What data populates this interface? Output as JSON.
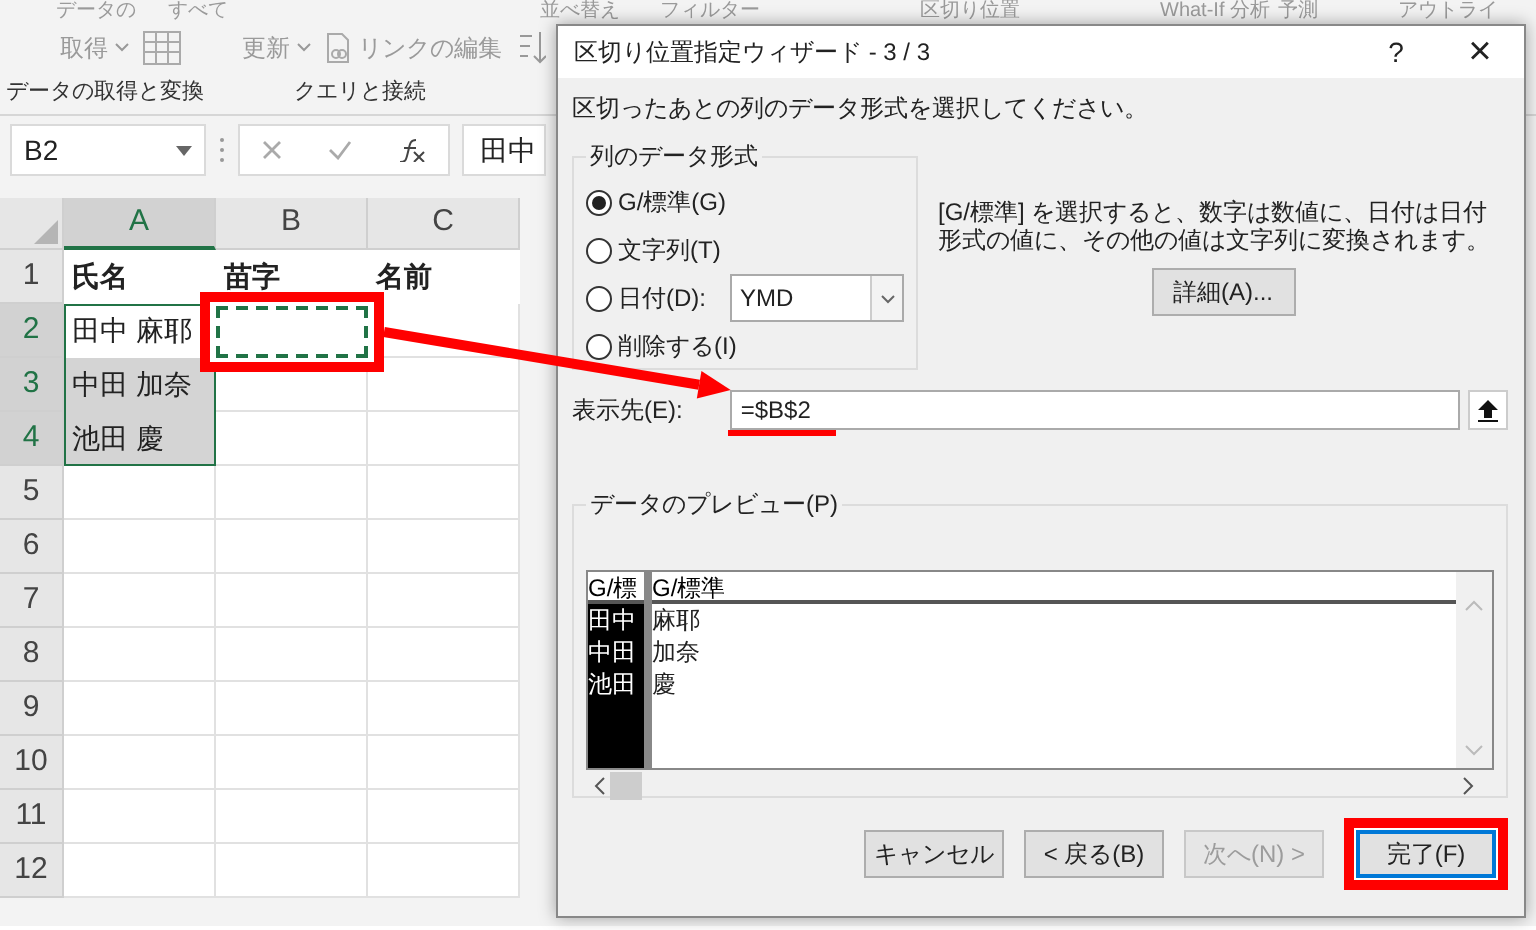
{
  "ribbon": {
    "top_items": [
      "データの",
      "すべて",
      "並べ替え",
      "フィルター",
      "区切り位置",
      "What-If 分析",
      "予測",
      "アウトライ"
    ],
    "buttons": [
      {
        "label": "取得",
        "kind": "dropdown_table"
      },
      {
        "label": "更新",
        "kind": "dropdown"
      },
      {
        "label": "リンクの編集",
        "kind": "link"
      },
      {
        "kind": "sort"
      }
    ],
    "groups": [
      "データの取得と変換",
      "クエリと接続"
    ]
  },
  "formula_bar": {
    "name_box": "B2",
    "value": "田中"
  },
  "sheet": {
    "columns": [
      {
        "label": "A",
        "selected": true
      },
      {
        "label": "B",
        "selected": false
      },
      {
        "label": "C",
        "selected": false
      }
    ],
    "rows": [
      {
        "header": "1",
        "selected": false,
        "kind": "heading",
        "cells": [
          {
            "text": "氏名",
            "selected": false
          },
          {
            "text": "苗字",
            "selected": false
          },
          {
            "text": "名前",
            "selected": false
          }
        ]
      },
      {
        "header": "2",
        "selected": true,
        "kind": "data",
        "cells": [
          {
            "text": "田中 麻耶",
            "selected": true,
            "active": true
          },
          {
            "highlighted": true
          }
        ]
      },
      {
        "header": "3",
        "selected": true,
        "kind": "data",
        "cells": [
          {
            "text": "中田 加奈",
            "selected": true,
            "active": false
          }
        ]
      },
      {
        "header": "4",
        "selected": true,
        "kind": "data",
        "cells": [
          {
            "text": "池田 慶",
            "selected": true,
            "active": false
          }
        ]
      },
      {
        "header": "5",
        "selected": false,
        "kind": "data"
      },
      {
        "header": "6",
        "selected": false,
        "kind": "data"
      },
      {
        "header": "7",
        "selected": false,
        "kind": "data"
      },
      {
        "header": "8",
        "selected": false,
        "kind": "data"
      },
      {
        "header": "9",
        "selected": false,
        "kind": "data"
      },
      {
        "header": "10",
        "selected": false,
        "kind": "data"
      },
      {
        "header": "11",
        "selected": false,
        "kind": "data"
      },
      {
        "header": "12",
        "selected": false,
        "kind": "data"
      }
    ]
  },
  "dialog": {
    "title": "区切り位置指定ウィザード - 3 / 3",
    "help": "?",
    "close": "×",
    "instruction": "区切ったあとの列のデータ形式を選択してください。",
    "format_group": {
      "title": "列のデータ形式",
      "options": [
        {
          "label": "G/標準(G)",
          "selected": true,
          "kind": "plain"
        },
        {
          "label": "文字列(T)",
          "selected": false,
          "kind": "plain"
        },
        {
          "label": "日付(D):",
          "selected": false,
          "kind": "date",
          "dropdown": "YMD"
        },
        {
          "label": "削除する(I)",
          "selected": false,
          "kind": "plain"
        }
      ]
    },
    "description": "[G/標準] を選択すると、数字は数値に、日付は日付形式の値に、その他の値は文字列に変換されます。",
    "advanced_button": "詳細(A)...",
    "destination": {
      "label": "表示先(E):",
      "value": "=$B$2",
      "highlighted": true
    },
    "preview": {
      "title": "データのプレビュー(P)",
      "headers": [
        {
          "label": "G/標",
          "selected": true
        },
        {
          "label": "G/標準",
          "selected": false
        }
      ],
      "rows": [
        [
          "田中",
          "麻耶"
        ],
        [
          "中田",
          "加奈"
        ],
        [
          "池田",
          "慶"
        ]
      ]
    },
    "buttons": [
      {
        "label": "キャンセル",
        "disabled": false,
        "default": false,
        "highlighted": false
      },
      {
        "label": "< 戻る(B)",
        "disabled": false,
        "default": false,
        "highlighted": false
      },
      {
        "label": "次へ(N) >",
        "disabled": true,
        "default": false,
        "highlighted": false
      },
      {
        "label": "完了(F)",
        "disabled": false,
        "default": true,
        "highlighted": true
      }
    ]
  }
}
